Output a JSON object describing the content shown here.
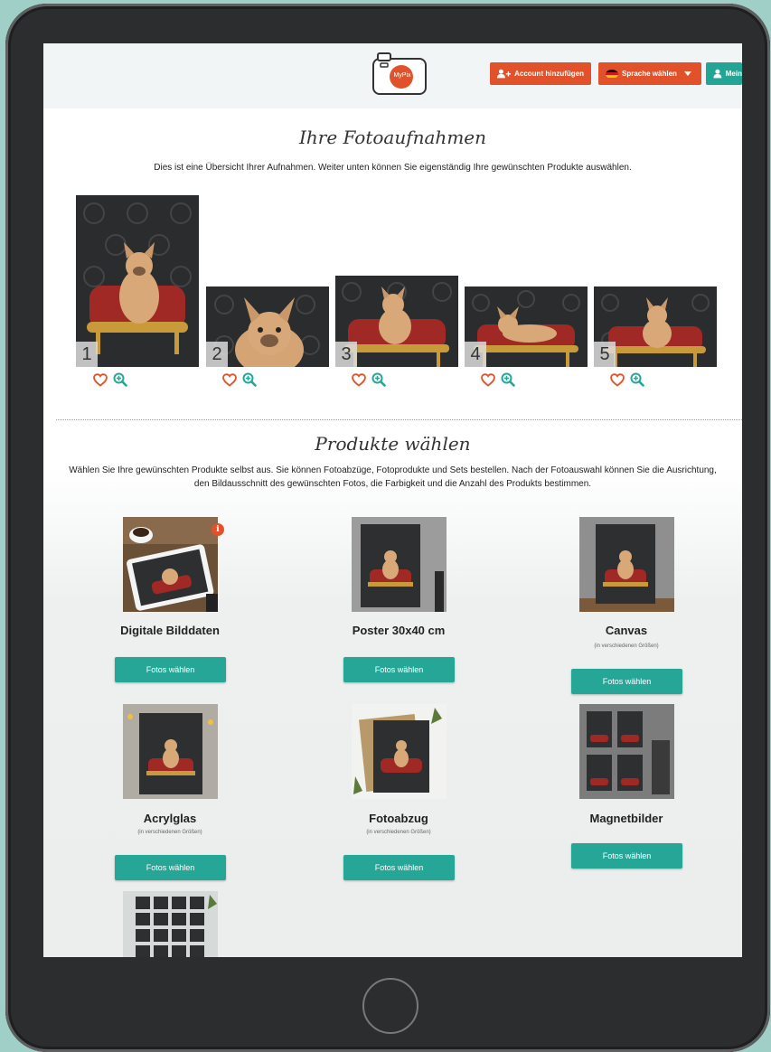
{
  "header": {
    "logo_text": "MyPix",
    "add_account_label": "Account hinzufügen",
    "language_label": "Sprache wählen",
    "account_label": "Mein"
  },
  "photos_section": {
    "title": "Ihre Fotoaufnahmen",
    "description": "Dies ist eine Übersicht Ihrer Aufnahmen. Weiter unten können Sie eigenständig Ihre gewünschten Produkte auswählen.",
    "photos": [
      {
        "number": "1"
      },
      {
        "number": "2"
      },
      {
        "number": "3"
      },
      {
        "number": "4"
      },
      {
        "number": "5"
      }
    ]
  },
  "products_section": {
    "title": "Produkte wählen",
    "description": "Wählen Sie Ihre gewünschten Produkte selbst aus. Sie können Fotoabzüge, Fotoprodukte und Sets bestellen. Nach der Fotoauswahl können Sie die Ausrichtung, den Bildausschnitt des gewünschten Fotos, die Farbigkeit und die Anzahl des Produkts bestimmen.",
    "button_label": "Fotos wählen",
    "products": [
      {
        "name": "Digitale Bilddaten",
        "subtitle": ""
      },
      {
        "name": "Poster 30x40 cm",
        "subtitle": ""
      },
      {
        "name": "Canvas",
        "subtitle": "(in verschiedenen Größen)"
      },
      {
        "name": "Acrylglas",
        "subtitle": "(in verschiedenen Größen)"
      },
      {
        "name": "Fotoabzug",
        "subtitle": "(in verschiedenen Größen)"
      },
      {
        "name": "Magnetbilder",
        "subtitle": ""
      }
    ],
    "info_badge": "i"
  },
  "colors": {
    "accent_orange": "#e2522a",
    "accent_teal": "#25a697",
    "heart": "#e2522a",
    "zoom": "#25a697"
  },
  "icons": [
    "camera-logo-icon",
    "add-user-icon",
    "german-flag-icon",
    "caret-down-icon",
    "user-icon",
    "heart-icon",
    "zoom-in-icon",
    "info-icon",
    "home-button"
  ]
}
